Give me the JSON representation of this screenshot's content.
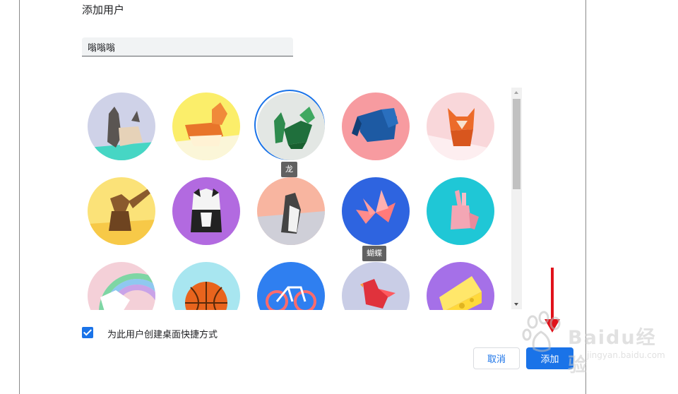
{
  "dialog": {
    "title": "添加用户",
    "name_value": "嗡嗡嗡",
    "checkbox_label": "为此用户创建桌面快捷方式",
    "checkbox_checked": true,
    "cancel_label": "取消",
    "add_label": "添加"
  },
  "avatars": [
    {
      "name": "cat",
      "bg": "#cfd2e8",
      "accent": "#46d6c4"
    },
    {
      "name": "corgi",
      "bg": "#fbee6a",
      "accent": "#e8752a"
    },
    {
      "name": "dragon",
      "bg": "#e3e7e4",
      "accent": "#2e8b4e",
      "selected": true
    },
    {
      "name": "elephant",
      "bg": "#f79ba0",
      "accent": "#1d5aa3"
    },
    {
      "name": "fox",
      "bg": "#f9d7da",
      "accent": "#ec6b2a"
    },
    {
      "name": "monkey",
      "bg": "#fbe278",
      "accent": "#8a5a2d"
    },
    {
      "name": "panda",
      "bg": "#b26ae0",
      "accent": "#222222"
    },
    {
      "name": "penguin",
      "bg": "#f8b5a0",
      "accent": "#444444"
    },
    {
      "name": "butterfly",
      "bg": "#2e64e0",
      "accent": "#ff8c8c"
    },
    {
      "name": "rabbit",
      "bg": "#1fc7d6",
      "accent": "#f3a6b4"
    },
    {
      "name": "unicorn",
      "bg": "#f4d0d8",
      "accent": "#ffffff"
    },
    {
      "name": "basketball",
      "bg": "#a8e6f0",
      "accent": "#e8641d"
    },
    {
      "name": "bike",
      "bg": "#2f7ff0",
      "accent": "#ff6b6b"
    },
    {
      "name": "bird",
      "bg": "#c9cde6",
      "accent": "#e0323c"
    },
    {
      "name": "cheese",
      "bg": "#a570e8",
      "accent": "#ffd93b"
    }
  ],
  "tooltips": {
    "dragon": "龙",
    "butterfly": "蝴蝶"
  },
  "watermark": {
    "text": "Baidu经验",
    "url": "jingyan.baidu.com"
  }
}
